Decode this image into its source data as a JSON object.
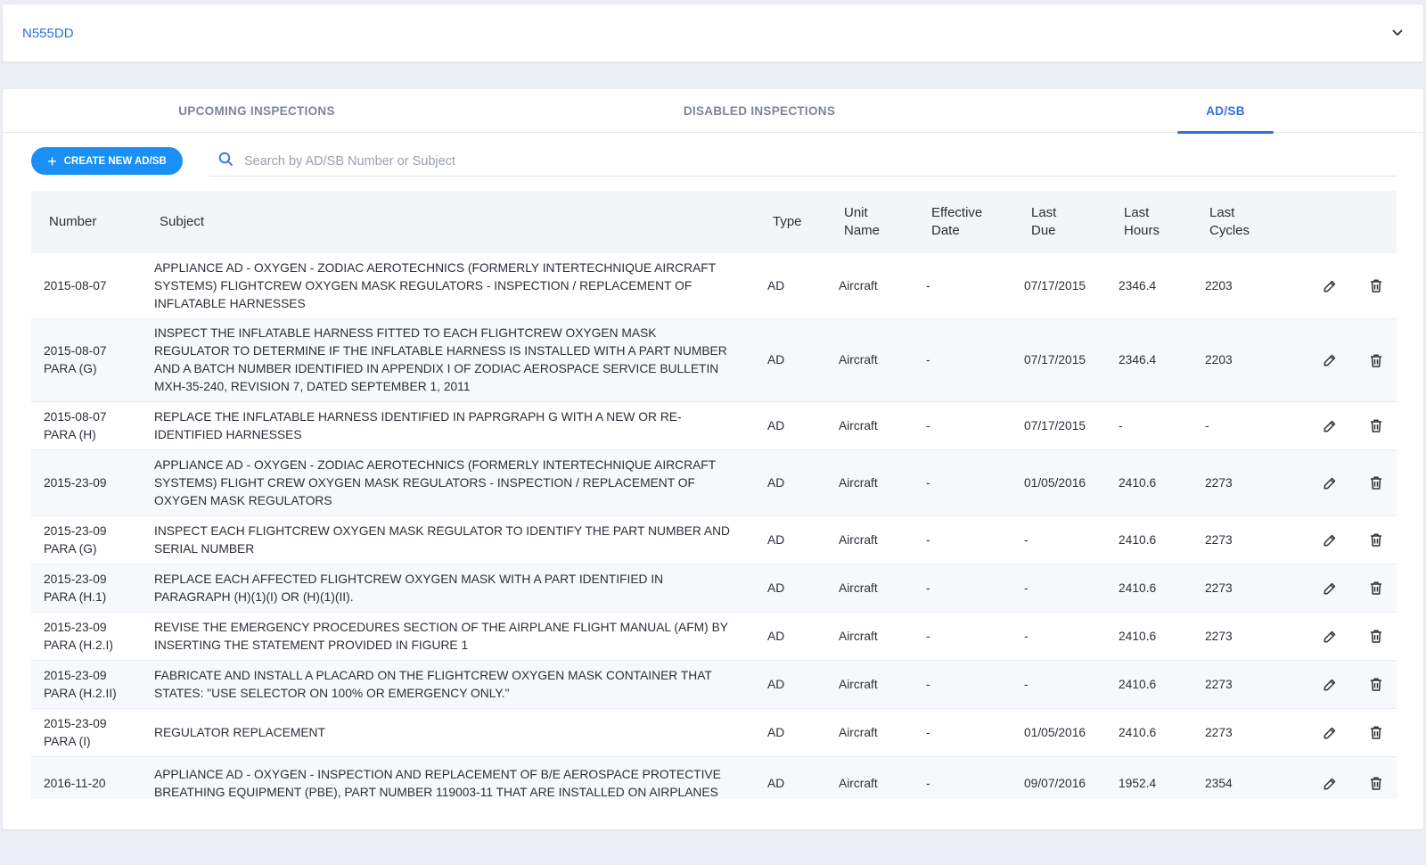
{
  "aircraft": {
    "tail_number": "N555DD"
  },
  "tabs": [
    {
      "label": "UPCOMING INSPECTIONS",
      "active": false
    },
    {
      "label": "DISABLED INSPECTIONS",
      "active": false
    },
    {
      "label": "AD/SB",
      "active": true
    }
  ],
  "toolbar": {
    "create_label": "CREATE NEW AD/SB",
    "search_placeholder": "Search by AD/SB Number or Subject"
  },
  "table": {
    "columns": [
      "Number",
      "Subject",
      "Type",
      "Unit\nName",
      "Effective\nDate",
      "Last\nDue",
      "Last\nHours",
      "Last\nCycles"
    ],
    "rows": [
      {
        "number": "2015-08-07",
        "subject": "APPLIANCE AD - OXYGEN - ZODIAC AEROTECHNICS (FORMERLY INTERTECHNIQUE AIRCRAFT SYSTEMS) FLIGHTCREW OXYGEN MASK REGULATORS - INSPECTION / REPLACEMENT OF INFLATABLE HARNESSES",
        "type": "AD",
        "unit": "Aircraft",
        "effective": "-",
        "due": "07/17/2015",
        "hours": "2346.4",
        "cycles": "2203"
      },
      {
        "number": "2015-08-07\nPARA (G)",
        "subject": "INSPECT THE INFLATABLE HARNESS FITTED TO EACH FLIGHTCREW OXYGEN MASK REGULATOR TO DETERMINE IF THE INFLATABLE HARNESS IS INSTALLED WITH A PART NUMBER AND A BATCH NUMBER IDENTIFIED IN APPENDIX I OF ZODIAC AEROSPACE SERVICE BULLETIN MXH-35-240, REVISION 7, DATED SEPTEMBER 1, 2011",
        "type": "AD",
        "unit": "Aircraft",
        "effective": "-",
        "due": "07/17/2015",
        "hours": "2346.4",
        "cycles": "2203"
      },
      {
        "number": "2015-08-07\nPARA (H)",
        "subject": "REPLACE THE INFLATABLE HARNESS IDENTIFIED IN PAPRGRAPH G WITH A NEW OR RE-IDENTIFIED HARNESSES",
        "type": "AD",
        "unit": "Aircraft",
        "effective": "-",
        "due": "07/17/2015",
        "hours": "-",
        "cycles": "-"
      },
      {
        "number": "2015-23-09",
        "subject": "APPLIANCE AD - OXYGEN - ZODIAC AEROTECHNICS (FORMERLY INTERTECHNIQUE AIRCRAFT SYSTEMS) FLIGHT CREW OXYGEN MASK REGULATORS - INSPECTION / REPLACEMENT OF OXYGEN MASK REGULATORS",
        "type": "AD",
        "unit": "Aircraft",
        "effective": "-",
        "due": "01/05/2016",
        "hours": "2410.6",
        "cycles": "2273"
      },
      {
        "number": "2015-23-09\nPARA (G)",
        "subject": "INSPECT EACH FLIGHTCREW OXYGEN MASK REGULATOR TO IDENTIFY THE PART NUMBER AND SERIAL NUMBER",
        "type": "AD",
        "unit": "Aircraft",
        "effective": "-",
        "due": "-",
        "hours": "2410.6",
        "cycles": "2273"
      },
      {
        "number": "2015-23-09\nPARA (H.1)",
        "subject": "REPLACE EACH AFFECTED FLIGHTCREW OXYGEN MASK WITH A PART IDENTIFIED IN PARAGRAPH (H)(1)(I) OR (H)(1)(II).",
        "type": "AD",
        "unit": "Aircraft",
        "effective": "-",
        "due": "-",
        "hours": "2410.6",
        "cycles": "2273"
      },
      {
        "number": "2015-23-09\nPARA (H.2.I)",
        "subject": "REVISE THE EMERGENCY PROCEDURES SECTION OF THE AIRPLANE FLIGHT MANUAL (AFM) BY INSERTING THE STATEMENT PROVIDED IN FIGURE 1",
        "type": "AD",
        "unit": "Aircraft",
        "effective": "-",
        "due": "-",
        "hours": "2410.6",
        "cycles": "2273"
      },
      {
        "number": "2015-23-09\nPARA (H.2.II)",
        "subject": "FABRICATE AND INSTALL A PLACARD ON THE FLIGHTCREW OXYGEN MASK CONTAINER THAT STATES: \"USE SELECTOR ON 100% OR EMERGENCY ONLY.\"",
        "type": "AD",
        "unit": "Aircraft",
        "effective": "-",
        "due": "-",
        "hours": "2410.6",
        "cycles": "2273"
      },
      {
        "number": "2015-23-09\nPARA (I)",
        "subject": "REGULATOR REPLACEMENT",
        "type": "AD",
        "unit": "Aircraft",
        "effective": "-",
        "due": "01/05/2016",
        "hours": "2410.6",
        "cycles": "2273"
      },
      {
        "number": "2016-11-20",
        "subject": "APPLIANCE AD - OXYGEN - INSPECTION AND REPLACEMENT OF B/E AEROSPACE PROTECTIVE BREATHING EQUIPMENT (PBE), PART NUMBER 119003-11 THAT ARE INSTALLED ON AIRPLANES",
        "type": "AD",
        "unit": "Aircraft",
        "effective": "-",
        "due": "09/07/2016",
        "hours": "1952.4",
        "cycles": "2354"
      }
    ]
  },
  "colors": {
    "accent": "#2f6fe0",
    "button": "#1a8ff5"
  },
  "icons": {
    "edit": "pencil-icon",
    "delete": "trash-icon",
    "search": "search-icon",
    "dropdown": "chevron-down-icon",
    "add": "plus-icon"
  }
}
